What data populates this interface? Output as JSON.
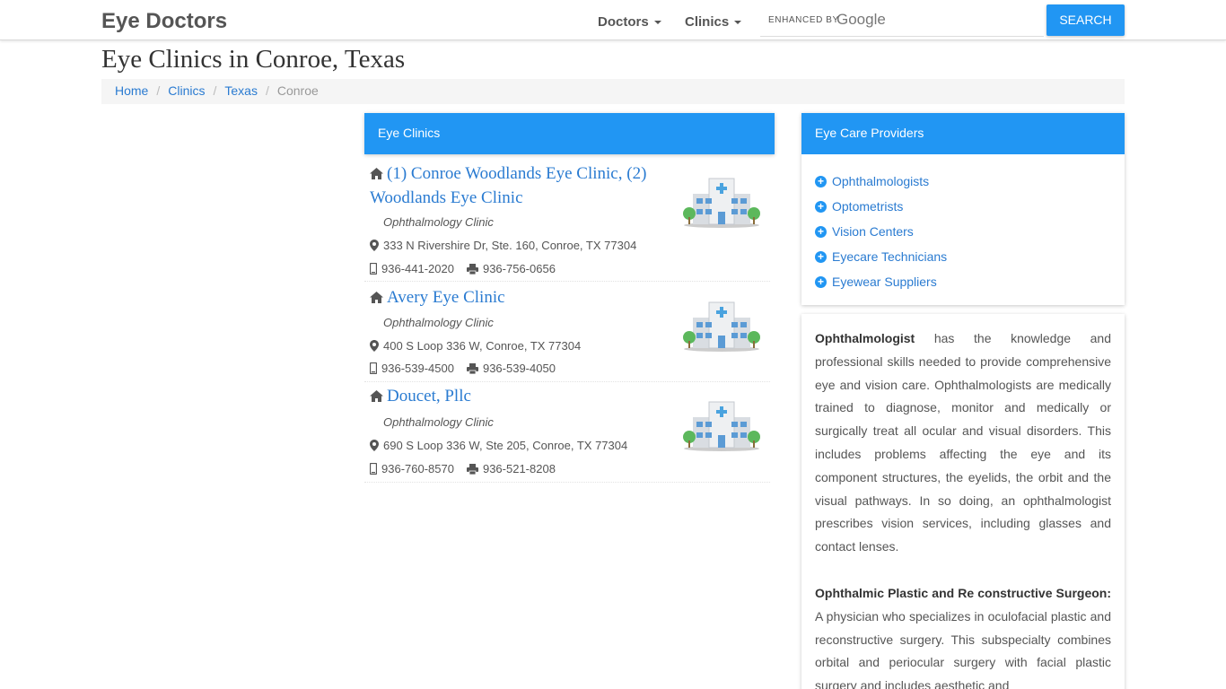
{
  "navbar": {
    "brand": "Eye Doctors",
    "doctors_label": "Doctors",
    "clinics_label": "Clinics",
    "search_enhanced": "ENHANCED BY",
    "search_google": "Google",
    "search_button": "SEARCH"
  },
  "page": {
    "title": "Eye Clinics in Conroe, Texas"
  },
  "breadcrumb": {
    "home": "Home",
    "clinics": "Clinics",
    "state": "Texas",
    "city": "Conroe",
    "separator": "/"
  },
  "clinics_panel": {
    "title": "Eye Clinics",
    "items": [
      {
        "name": "(1) Conroe Woodlands Eye Clinic, (2) Woodlands Eye Clinic",
        "type": "Ophthalmology Clinic",
        "address": "333 N Rivershire Dr, Ste. 160, Conroe, TX 77304",
        "phone": "936-441-2020",
        "fax": "936-756-0656"
      },
      {
        "name": "Avery Eye Clinic",
        "type": "Ophthalmology Clinic",
        "address": "400 S Loop 336 W, Conroe, TX 77304",
        "phone": "936-539-4500",
        "fax": "936-539-4050"
      },
      {
        "name": "Doucet, Pllc",
        "type": "Ophthalmology Clinic",
        "address": "690 S Loop 336 W, Ste 205, Conroe, TX 77304",
        "phone": "936-760-8570",
        "fax": "936-521-8208"
      }
    ]
  },
  "providers_panel": {
    "title": "Eye Care Providers",
    "items": [
      "Ophthalmologists",
      "Optometrists",
      "Vision Centers",
      "Eyecare Technicians",
      "Eyewear Suppliers"
    ]
  },
  "info": {
    "p1_term": "Ophthalmologist",
    "p1_text": " has the knowledge and professional skills needed to provide comprehensive eye and vision care. Ophthalmologists are medically trained to diagnose, monitor and medically or surgically treat all ocular and visual disorders. This includes problems affecting the eye and its component structures, the eyelids, the orbit and the visual pathways. In so doing, an ophthalmologist prescribes vision services, including glasses and contact lenses.",
    "p2_term": "Ophthalmic Plastic and Re constructive Surgeon:",
    "p2_text": " A physician who specializes in oculofacial plastic and reconstructive surgery. This subspecialty combines orbital and periocular surgery with facial plastic surgery and includes aesthetic and"
  },
  "colors": {
    "accent": "#2196f3",
    "link": "#2a7bd1",
    "breadcrumb_bg": "#f5f5f5"
  },
  "icons": [
    "home-icon",
    "map-marker-icon",
    "phone-icon",
    "fax-icon",
    "plus-circle-icon",
    "hospital-building-icon",
    "caret-down-icon"
  ]
}
